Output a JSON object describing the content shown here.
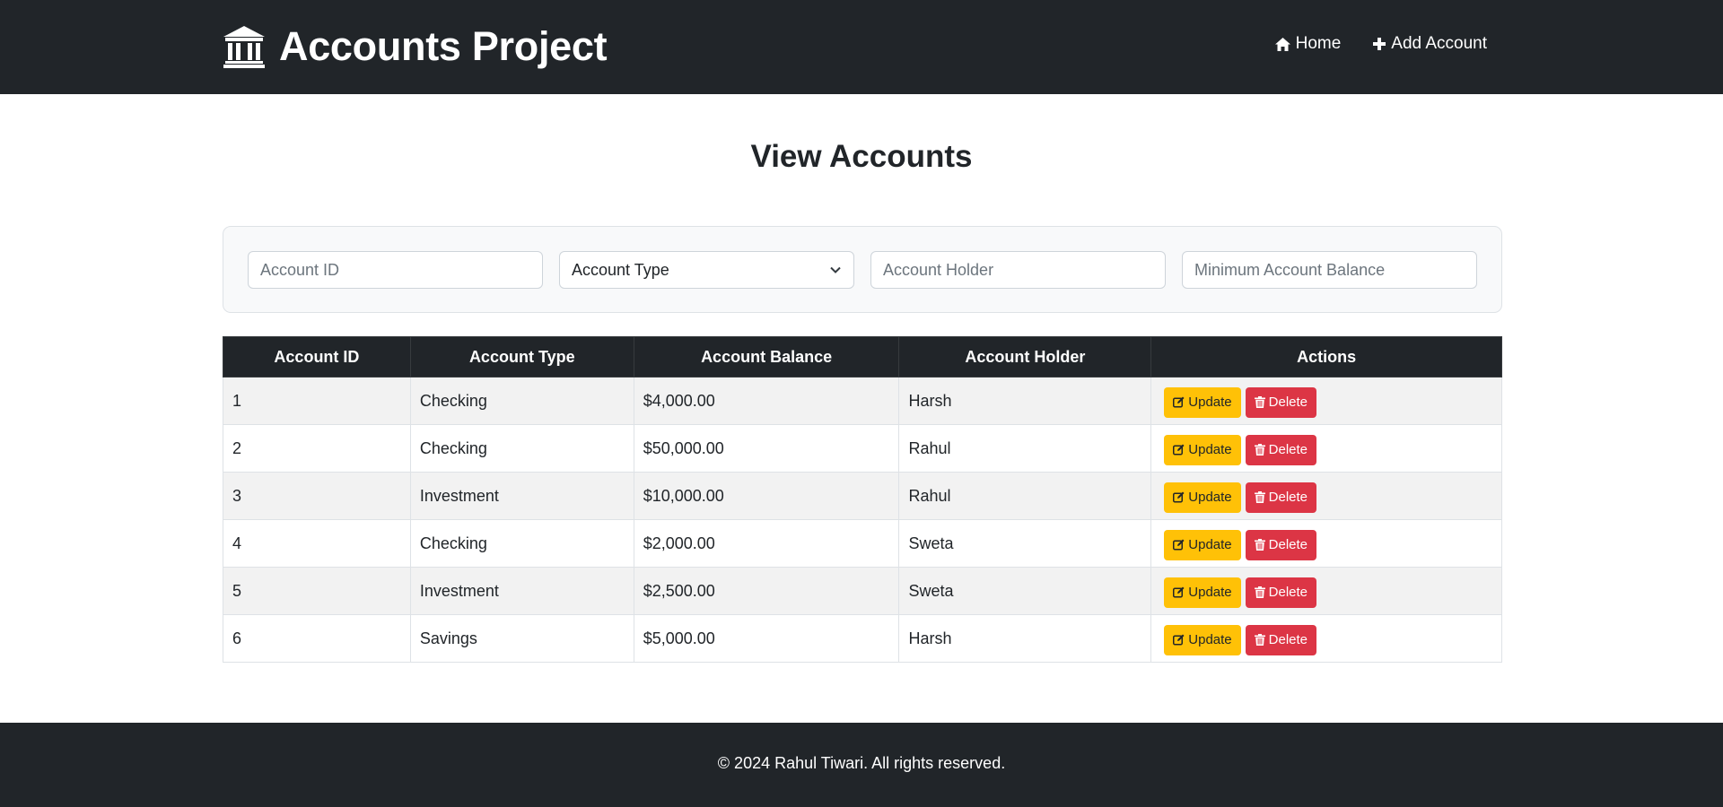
{
  "navbar": {
    "brand": "Accounts Project",
    "brand_icon": "bank-icon",
    "links": [
      {
        "label": "Home",
        "icon": "home-icon"
      },
      {
        "label": "Add Account",
        "icon": "plus-icon"
      }
    ]
  },
  "page": {
    "title": "View Accounts"
  },
  "filters": {
    "account_id_placeholder": "Account ID",
    "account_type_selected": "Account Type",
    "account_holder_placeholder": "Account Holder",
    "min_balance_placeholder": "Minimum Account Balance"
  },
  "table": {
    "headers": [
      "Account ID",
      "Account Type",
      "Account Balance",
      "Account Holder",
      "Actions"
    ],
    "rows": [
      {
        "id": "1",
        "type": "Checking",
        "balance": "$4,000.00",
        "holder": "Harsh"
      },
      {
        "id": "2",
        "type": "Checking",
        "balance": "$50,000.00",
        "holder": "Rahul"
      },
      {
        "id": "3",
        "type": "Investment",
        "balance": "$10,000.00",
        "holder": "Rahul"
      },
      {
        "id": "4",
        "type": "Checking",
        "balance": "$2,000.00",
        "holder": "Sweta"
      },
      {
        "id": "5",
        "type": "Investment",
        "balance": "$2,500.00",
        "holder": "Sweta"
      },
      {
        "id": "6",
        "type": "Savings",
        "balance": "$5,000.00",
        "holder": "Harsh"
      }
    ],
    "update_label": "Update",
    "delete_label": "Delete"
  },
  "footer": {
    "text": "© 2024 Rahul Tiwari. All rights reserved."
  },
  "colors": {
    "dark": "#212529",
    "update": "#ffc107",
    "delete": "#dc3545",
    "stripe": "#f2f2f2"
  }
}
